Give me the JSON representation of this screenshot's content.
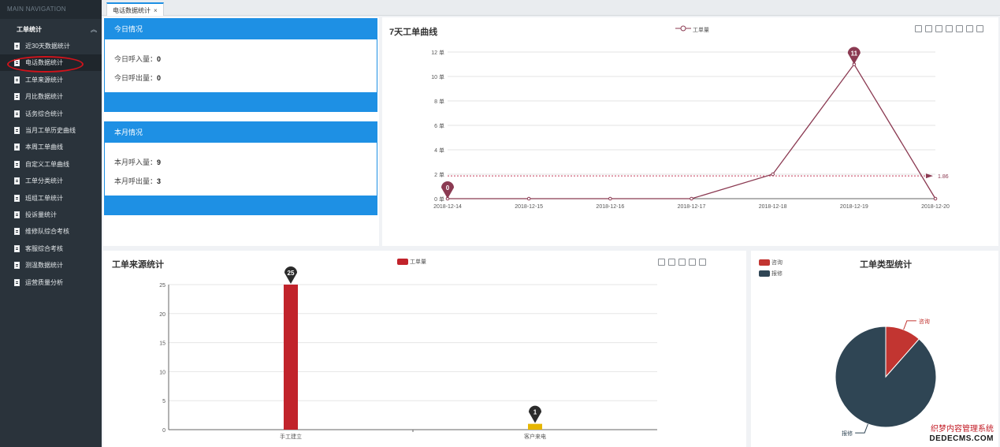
{
  "sidebar": {
    "nav_heading": "MAIN NAVIGATION",
    "group_label": "工单统计",
    "items": [
      {
        "label": "近30天数据统计"
      },
      {
        "label": "电话数据统计"
      },
      {
        "label": "工单来源统计"
      },
      {
        "label": "月比数据统计"
      },
      {
        "label": "话务综合统计"
      },
      {
        "label": "当月工单历史曲线"
      },
      {
        "label": "本周工单曲线"
      },
      {
        "label": "自定义工单曲线"
      },
      {
        "label": "工单分类统计"
      },
      {
        "label": "班组工单统计"
      },
      {
        "label": "投诉量统计"
      },
      {
        "label": "维修队综合考核"
      },
      {
        "label": "客服综合考核"
      },
      {
        "label": "测温数据统计"
      },
      {
        "label": "运营质量分析"
      }
    ],
    "active_index": 1
  },
  "tabs": [
    {
      "label": "电话数据统计",
      "close": "×"
    }
  ],
  "today": {
    "title": "今日情况",
    "in_label": "今日呼入量：",
    "in_value": "0",
    "out_label": "今日呼出量：",
    "out_value": "0"
  },
  "month": {
    "title": "本月情况",
    "in_label": "本月呼入量：",
    "in_value": "9",
    "out_label": "本月呼出量：",
    "out_value": "3"
  },
  "colors": {
    "accent": "#1e90e4",
    "line": "#8b3a52",
    "bar_red": "#c1232b",
    "bar_yellow": "#e6b600",
    "pie_dark": "#2f4554",
    "pie_red": "#c23531"
  },
  "watermark": {
    "line1": "织梦内容管理系统",
    "line2": "DEDECMS.COM"
  },
  "chart_data": [
    {
      "type": "line",
      "title": "7天工单曲线",
      "series": [
        {
          "name": "工单量",
          "values": [
            0,
            0,
            0,
            0,
            2,
            11,
            0
          ]
        }
      ],
      "x": [
        "2018-12-14",
        "2018-12-15",
        "2018-12-16",
        "2018-12-17",
        "2018-12-18",
        "2018-12-19",
        "2018-12-20"
      ],
      "yticks": [
        "0 单",
        "2 单",
        "4 单",
        "6 单",
        "8 单",
        "10 单",
        "12 单"
      ],
      "ylim": [
        0,
        12
      ],
      "mark_points": [
        {
          "x": "2018-12-14",
          "label": "0"
        },
        {
          "x": "2018-12-19",
          "label": "11"
        }
      ],
      "mark_line": {
        "value": 1.86,
        "label": "1.86"
      },
      "legend_position": "top-center",
      "grid": true
    },
    {
      "type": "bar",
      "title": "工单来源统计",
      "categories": [
        "手工建立",
        "客户来电"
      ],
      "series": [
        {
          "name": "工单量",
          "values": [
            25,
            1
          ]
        }
      ],
      "yticks": [
        "0",
        "5",
        "10",
        "15",
        "20",
        "25"
      ],
      "ylim": [
        0,
        25
      ],
      "mark_points": [
        {
          "category": "手工建立",
          "label": "25"
        },
        {
          "category": "客户来电",
          "label": "1"
        }
      ],
      "legend_position": "top-center",
      "grid": true
    },
    {
      "type": "pie",
      "title": "工单类型统计",
      "slices": [
        {
          "name": "咨询",
          "value": 11.5
        },
        {
          "name": "报修",
          "value": 88.5
        }
      ],
      "legend_position": "top-left"
    }
  ]
}
